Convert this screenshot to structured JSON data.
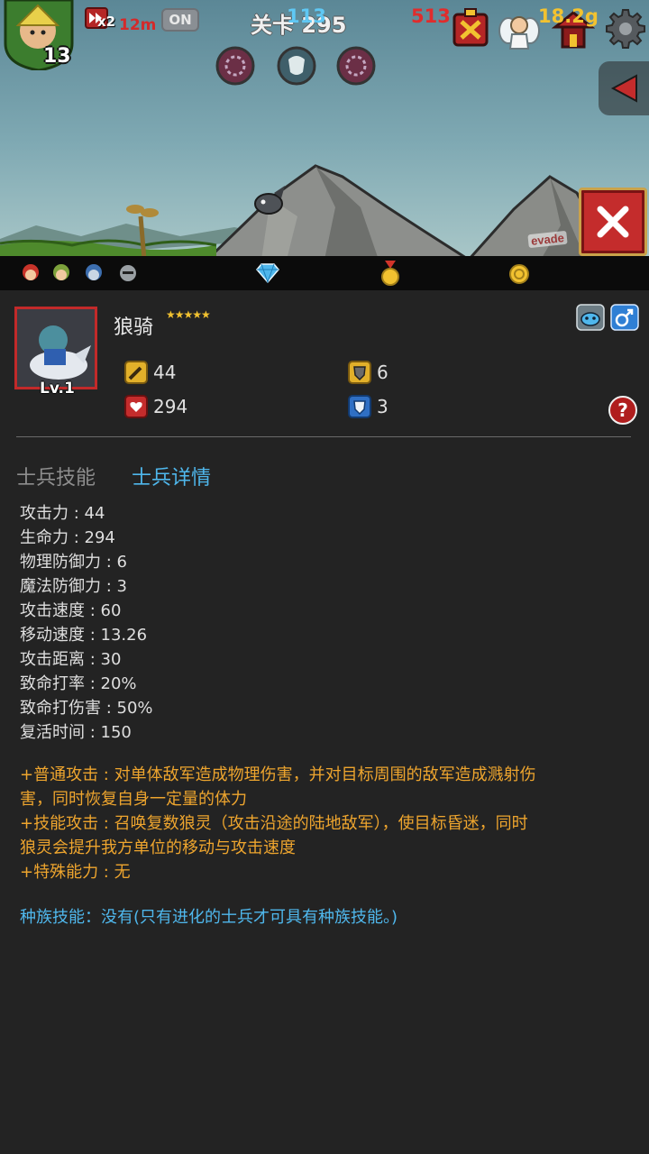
{
  "hud": {
    "player_level": "13",
    "speed_multiplier": "x2",
    "time": "12m",
    "auto_toggle": "ON",
    "stage_title": "关卡 295",
    "scene_sign": "evade"
  },
  "resources": {
    "gems": "113",
    "medals": "513",
    "gold": "18.2g"
  },
  "unit": {
    "name": "狼骑",
    "stars": "★★★★★",
    "level": "Lv.1",
    "attack": "44",
    "hp": "294",
    "physical_defense": "6",
    "magic_defense": "3"
  },
  "tabs": {
    "skills": "士兵技能",
    "details": "士兵详情"
  },
  "attributes": [
    "攻击力 : 44",
    "生命力 : 294",
    "物理防御力 : 6",
    "魔法防御力 : 3",
    "攻击速度 : 60",
    "移动速度 : 13.26",
    "攻击距离 : 30",
    "致命打率 : 20%",
    "致命打伤害 : 50%",
    "复活时间 : 150"
  ],
  "descriptions": {
    "normal_attack_1": "+普通攻击 : 对单体敌军造成物理伤害，并对目标周围的敌军造成溅射伤",
    "normal_attack_2": "害，同时恢复自身一定量的体力",
    "skill_attack_1": "+技能攻击 : 召唤复数狼灵（攻击沿途的陆地敌军），使目标昏迷，同时",
    "skill_attack_2": "狼灵会提升我方单位的移动与攻击速度",
    "special": "+特殊能力 : 无"
  },
  "race_skill": "种族技能：没有(只有进化的士兵才可具有种族技能。)",
  "colors": {
    "accent_blue": "#4fb7ec",
    "description_orange": "#eea52e",
    "medal_red": "#e02c2c",
    "gold_yellow": "#f2c230"
  }
}
